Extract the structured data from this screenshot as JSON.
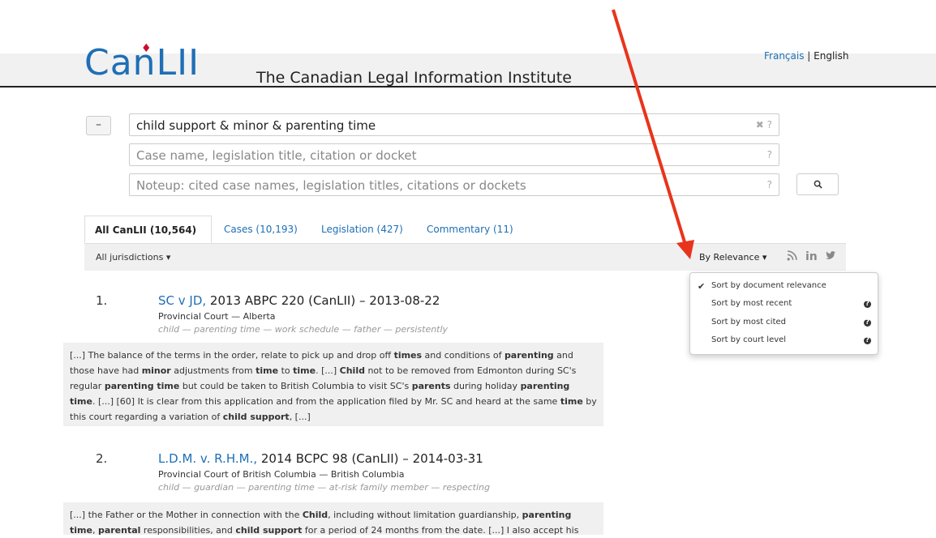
{
  "header": {
    "logo": "CanLII",
    "tagline": "The Canadian Legal Information Institute",
    "lang_fr": "Français",
    "lang_sep": "|",
    "lang_en": "English"
  },
  "search": {
    "collapse_label": "–",
    "query": "child support & minor & parenting time",
    "query_aux": "✖ ?",
    "case_placeholder": "Case name, legislation title, citation or docket",
    "case_aux": "?",
    "noteup_placeholder": "Noteup: cited case names, legislation titles, citations or dockets",
    "noteup_aux": "?",
    "button_icon": "search-icon"
  },
  "tabs": [
    {
      "label": "All CanLII (10,564)"
    },
    {
      "label": "Cases (10,193)"
    },
    {
      "label": "Legislation (427)"
    },
    {
      "label": "Commentary (11)"
    }
  ],
  "filter": {
    "jurisdictions": "All jurisdictions ▾",
    "sort": "By Relevance ▾",
    "social_icons": [
      "rss-icon",
      "linkedin-icon",
      "twitter-icon"
    ]
  },
  "sort_menu": [
    {
      "label": "Sort by document relevance",
      "checked": true
    },
    {
      "label": "Sort by most recent",
      "help": true
    },
    {
      "label": "Sort by most cited",
      "help": true
    },
    {
      "label": "Sort by court level",
      "help": true
    }
  ],
  "results": [
    {
      "num": "1.",
      "link": "SC v JD,",
      "rest": " 2013 ABPC 220 (CanLII) – 2013-08-22",
      "court": "Provincial Court — Alberta",
      "keywords": "child — parenting time — work schedule — father — persistently"
    },
    {
      "num": "2.",
      "link": "L.D.M. v. R.H.M.,",
      "rest": " 2014 BCPC 98 (CanLII) – 2014-03-31",
      "court": "Provincial Court of British Columbia — British Columbia",
      "keywords": "child — guardian — parenting time — at-risk family member — respecting"
    }
  ],
  "snippet1": {
    "s1": "[...]  The balance of the terms in the order, relate to pick up and drop off ",
    "b1": "times",
    "s2": " and conditions of ",
    "b2": "parenting",
    "s3": " and those have had ",
    "b3": "minor",
    "s4": " adjustments from ",
    "b4": "time",
    "s5": " to ",
    "b5": "time",
    "s6": ".  [...]   ",
    "b6": "Child",
    "s7": " not to be removed from Edmonton during SC's regular ",
    "b7": "parenting time",
    "s8": " but could be taken to British Columbia to visit SC's ",
    "b8": "parents",
    "s9": " during holiday ",
    "b9": "parenting time",
    "s10": ".  [...]  [60] It is clear from this application and from the application filed by Mr. SC and heard at the same ",
    "b10": "time",
    "s11": " by this court regarding a variation of ",
    "b11": "child support",
    "s12": ",  [...]"
  },
  "snippet2": {
    "s1": "[...]  the Father or the Mother in connection with the ",
    "b1": "Child",
    "s2": ", including without limitation guardianship, ",
    "b2": "parenting",
    "s3": " ",
    "b3": "time",
    "s4": ", ",
    "b4": "parental",
    "s5": " responsibilities, and ",
    "b5": "child support",
    "s6": " for a period of 24 months from the date.  [...]  I also accept his"
  }
}
